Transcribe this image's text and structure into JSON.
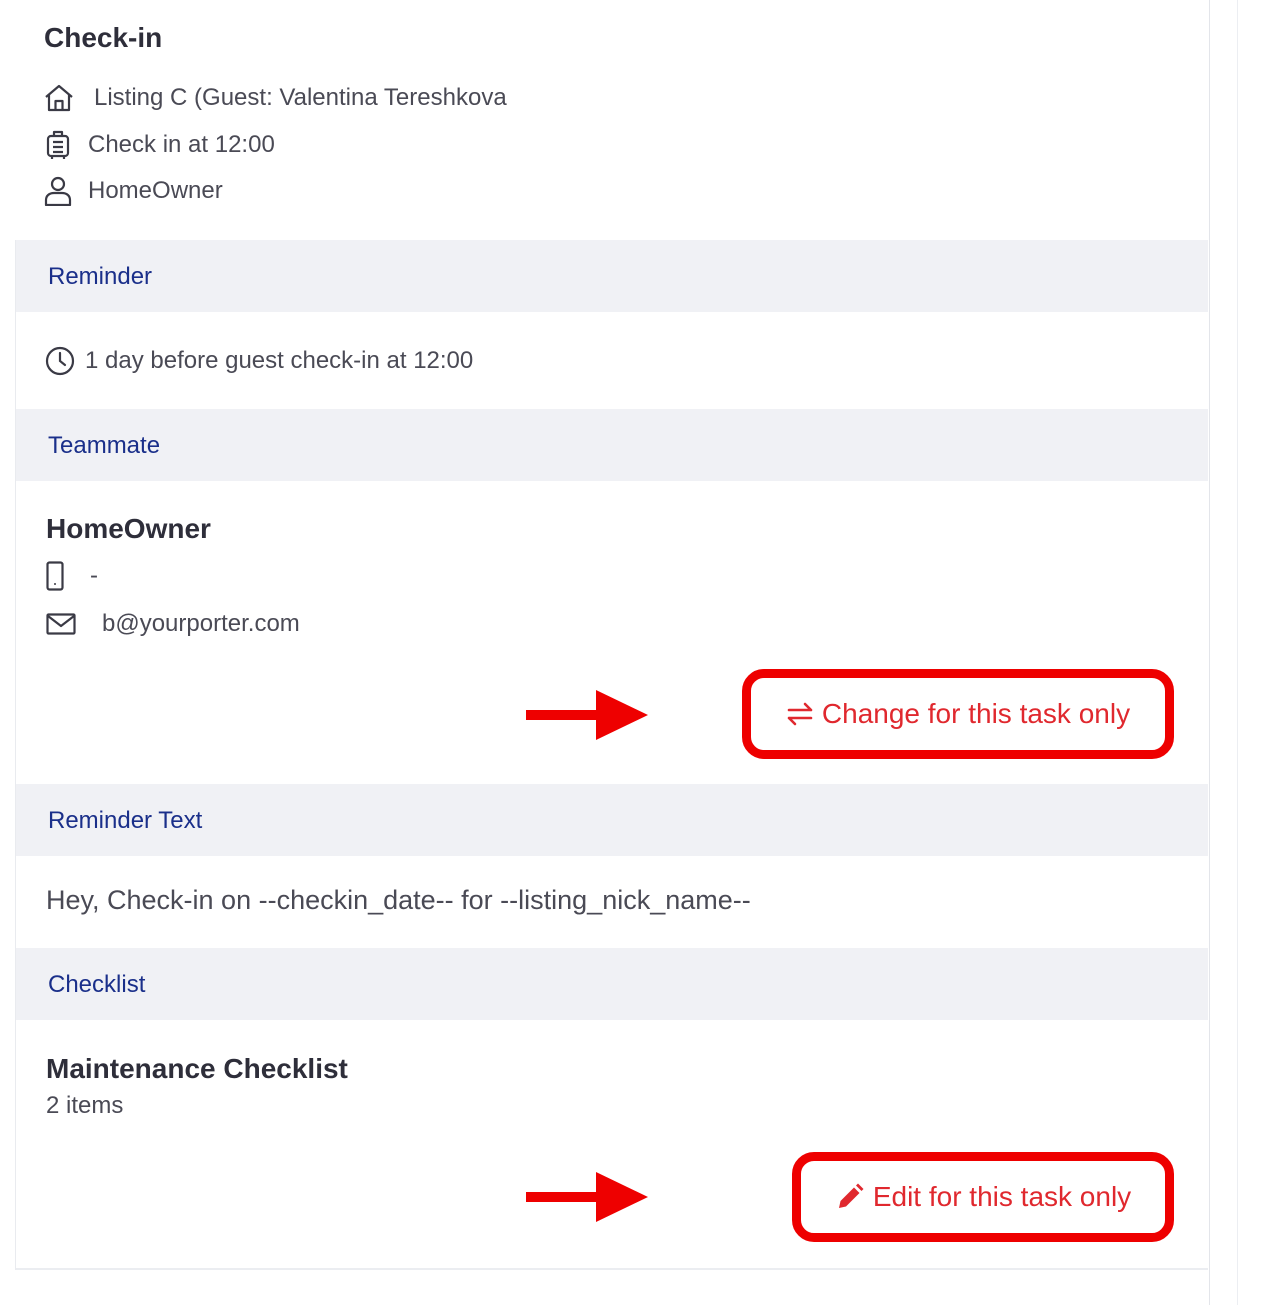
{
  "task": {
    "title": "Check-in",
    "listing": "Listing C (Guest: Valentina Tereshkova",
    "checkin": "Check in at 12:00",
    "owner": "HomeOwner"
  },
  "reminder": {
    "header": "Reminder",
    "text": "1 day before guest check-in at 12:00"
  },
  "teammate": {
    "header": "Teammate",
    "name": "HomeOwner",
    "phone": "-",
    "email": "b@yourporter.com",
    "change_button": "Change for this task only"
  },
  "reminder_text": {
    "header": "Reminder Text",
    "text": "Hey, Check-in on --checkin_date-- for --listing_nick_name--"
  },
  "checklist": {
    "header": "Checklist",
    "name": "Maintenance Checklist",
    "count": "2 items",
    "edit_button": "Edit for this task only"
  },
  "icons": {
    "listing": "home-icon",
    "checkin": "luggage-icon",
    "owner": "user-icon",
    "reminder": "clock-icon",
    "phone": "phone-icon",
    "email": "envelope-icon",
    "change": "swap-arrows-icon",
    "edit": "pencil-icon",
    "annotation": "red-arrow-icon"
  },
  "colors": {
    "section_header_bg": "#f0f1f5",
    "section_header_text": "#1a2f8a",
    "action_text": "#e0282e",
    "annotation_red": "#ee0000"
  }
}
